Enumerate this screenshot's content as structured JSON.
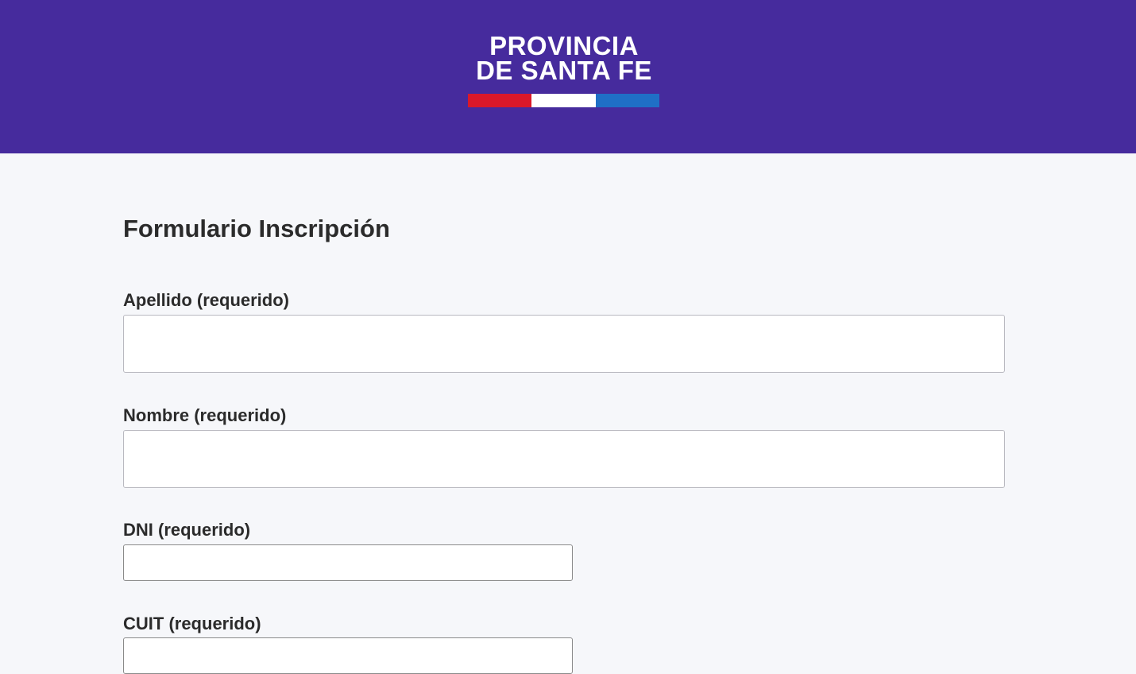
{
  "header": {
    "logo_line1": "PROVINCIA",
    "logo_line2": "DE SANTA FE",
    "background_color": "#462b9d",
    "flag_colors": [
      "#d9182a",
      "#ffffff",
      "#1f6fc6"
    ]
  },
  "form": {
    "title": "Formulario Inscripción",
    "fields": [
      {
        "label": "Apellido (requerido)",
        "value": "",
        "placeholder": ""
      },
      {
        "label": "Nombre (requerido)",
        "value": "",
        "placeholder": ""
      },
      {
        "label": "DNI (requerido)",
        "value": "",
        "placeholder": ""
      },
      {
        "label": "CUIT (requerido)",
        "value": "",
        "placeholder": ""
      }
    ]
  }
}
